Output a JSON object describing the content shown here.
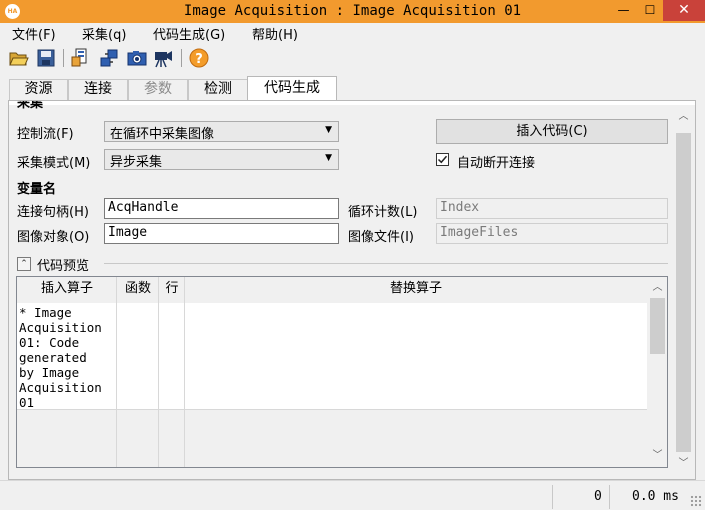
{
  "window": {
    "title": "Image Acquisition : Image Acquisition 01",
    "app_icon_text": "HA",
    "min_glyph": "—",
    "max_glyph": "☐",
    "close_glyph": "✕"
  },
  "menu": [
    "文件(F)",
    "采集(q)",
    "代码生成(G)",
    "帮助(H)"
  ],
  "toolbar": {
    "icons": [
      "open-folder-icon",
      "save-disk-icon",
      "device-properties-icon",
      "connect-device-icon",
      "snap-camera-icon",
      "live-camera-icon",
      "help-icon"
    ],
    "help_glyph": "?"
  },
  "tabs": [
    {
      "label": "资源",
      "state": "normal"
    },
    {
      "label": "连接",
      "state": "normal"
    },
    {
      "label": "参数",
      "state": "disabled"
    },
    {
      "label": "检测",
      "state": "normal"
    },
    {
      "label": "代码生成",
      "state": "active"
    }
  ],
  "acquisition": {
    "section_title": "采集",
    "control_flow_label": "控制流(F)",
    "control_flow_value": "在循环中采集图像",
    "mode_label": "采集模式(M)",
    "mode_value": "异步采集",
    "insert_code_button": "插入代码(C)",
    "auto_disconnect_label": "自动断开连接",
    "auto_disconnect_checked": true,
    "dropdown_glyph": "▼"
  },
  "variables": {
    "section_title": "变量名",
    "handle_label": "连接句柄(H)",
    "handle_value": "AcqHandle",
    "loop_label": "循环计数(L)",
    "loop_value": "Index",
    "image_label": "图像对象(O)",
    "image_value": "Image",
    "file_label": "图像文件(I)",
    "file_value": "ImageFiles"
  },
  "preview": {
    "section_title": "代码预览",
    "toggle_glyph": "⌃",
    "columns": [
      "插入算子",
      "函数",
      "行",
      "替换算子"
    ],
    "rows": [
      {
        "insert": "* Image\nAcquisition\n01: Code\ngenerated\nby Image\nAcquisition\n01",
        "func": "",
        "line": "",
        "replace": ""
      }
    ]
  },
  "scroll_glyphs": {
    "up": "︿",
    "down": "﹀"
  },
  "status": {
    "count": "0",
    "time": "0.0 ms"
  }
}
